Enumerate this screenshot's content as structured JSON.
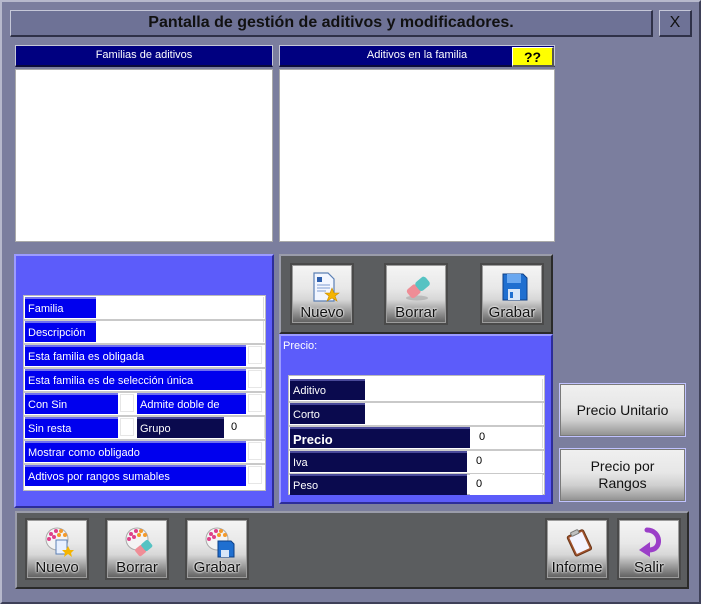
{
  "window": {
    "title": "Pantalla de gestión de aditivos y modificadores.",
    "close_label": "X"
  },
  "lists": {
    "families_header": "Familias de aditivos",
    "additives_header": "Aditivos en la familia",
    "help_label": "??"
  },
  "family_form": {
    "familia_label": "Familia",
    "familia_value": "",
    "descripcion_label": "Descripción",
    "descripcion_value": "",
    "obligada_label": "Esta familia es obligada",
    "seleccion_unica_label": "Esta familia es de selección única",
    "con_sin_label": "Con Sin",
    "admite_doble_label": "Admite doble de",
    "sin_resta_label": "Sin resta",
    "grupo_label": "Grupo",
    "grupo_value": "0",
    "mostrar_obligado_label": "Mostrar como obligado",
    "rangos_sumables_label": "Adtivos por rangos sumables"
  },
  "additive_toolbar": {
    "nuevo": "Nuevo",
    "borrar": "Borrar",
    "grabar": "Grabar"
  },
  "price_panel": {
    "title": "Precio:",
    "aditivo_label": "Aditivo",
    "aditivo_value": "",
    "corto_label": "Corto",
    "corto_value": "",
    "precio_label": "Precio",
    "precio_value": "0",
    "iva_label": "Iva",
    "iva_value": "0",
    "peso_label": "Peso",
    "peso_value": "0"
  },
  "side_buttons": {
    "precio_unitario": "Precio Unitario",
    "precio_rangos": "Precio por Rangos"
  },
  "bottom_toolbar": {
    "nuevo": "Nuevo",
    "borrar": "Borrar",
    "grabar": "Grabar",
    "informe": "Informe",
    "salir": "Salir"
  },
  "colors": {
    "header_navy": "#000080",
    "label_blue": "#0000ee",
    "panel_blue": "#5c5cfa",
    "help_yellow": "#ffff00",
    "window_gray": "#7b7e9e"
  }
}
